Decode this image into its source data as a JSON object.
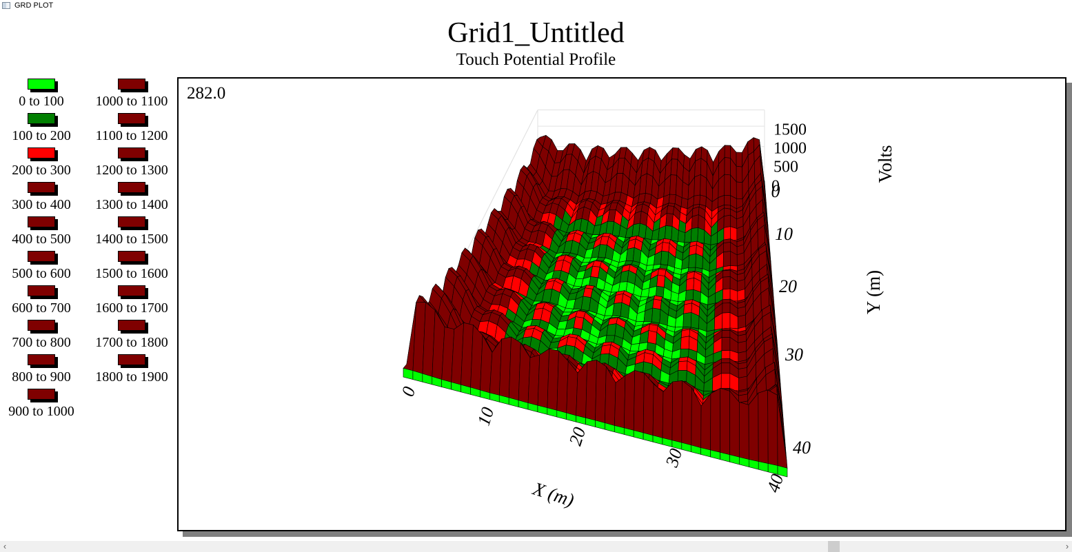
{
  "window": {
    "title": "GRD PLOT",
    "icon": "app-window-icon"
  },
  "header": {
    "title": "Grid1_Untitled",
    "subtitle": "Touch Potential Profile"
  },
  "plot": {
    "corner_value": "282.0"
  },
  "legend": {
    "items": [
      {
        "label": "0 to 100",
        "color": "#00ff00"
      },
      {
        "label": "100 to 200",
        "color": "#007f00"
      },
      {
        "label": "200 to 300",
        "color": "#ff0000"
      },
      {
        "label": "300 to 400",
        "color": "#7f0000"
      },
      {
        "label": "400 to 500",
        "color": "#7f0000"
      },
      {
        "label": "500 to 600",
        "color": "#7f0000"
      },
      {
        "label": "600 to 700",
        "color": "#7f0000"
      },
      {
        "label": "700 to 800",
        "color": "#7f0000"
      },
      {
        "label": "800 to 900",
        "color": "#7f0000"
      },
      {
        "label": "900 to 1000",
        "color": "#7f0000"
      },
      {
        "label": "1000 to 1100",
        "color": "#7f0000"
      },
      {
        "label": "1100 to 1200",
        "color": "#7f0000"
      },
      {
        "label": "1200 to 1300",
        "color": "#7f0000"
      },
      {
        "label": "1300 to 1400",
        "color": "#7f0000"
      },
      {
        "label": "1400 to 1500",
        "color": "#7f0000"
      },
      {
        "label": "1500 to 1600",
        "color": "#7f0000"
      },
      {
        "label": "1600 to 1700",
        "color": "#7f0000"
      },
      {
        "label": "1700 to 1800",
        "color": "#7f0000"
      },
      {
        "label": "1800 to 1900",
        "color": "#7f0000"
      }
    ]
  },
  "chart_data": {
    "type": "surface3d",
    "title": "Grid1_Untitled",
    "subtitle": "Touch Potential Profile",
    "xlabel": "X (m)",
    "ylabel": "Y (m)",
    "zlabel": "Volts",
    "xlim": [
      0,
      40
    ],
    "ylim": [
      0,
      40
    ],
    "zlim": [
      0,
      1900
    ],
    "x_ticks": [
      "0",
      "10",
      "20",
      "30",
      "40"
    ],
    "y_ticks": [
      "0",
      "10",
      "20",
      "30",
      "40"
    ],
    "z_ticks": [
      "0",
      "500",
      "1000",
      "1500"
    ],
    "grid_conductors": 10,
    "max_value_approx": 1850,
    "corner_peak_approx": 1850,
    "edge_peak_approx": 1400,
    "interior_peak_approx": 300,
    "interior_valley_approx": 0,
    "color_bands": [
      {
        "range": [
          0,
          100
        ],
        "color": "#00ff00"
      },
      {
        "range": [
          100,
          200
        ],
        "color": "#007f00"
      },
      {
        "range": [
          200,
          300
        ],
        "color": "#ff0000"
      },
      {
        "range": [
          300,
          1900
        ],
        "color": "#7f0000"
      }
    ]
  },
  "scrollbar": {
    "left_arrow": "‹",
    "right_arrow": "›"
  }
}
